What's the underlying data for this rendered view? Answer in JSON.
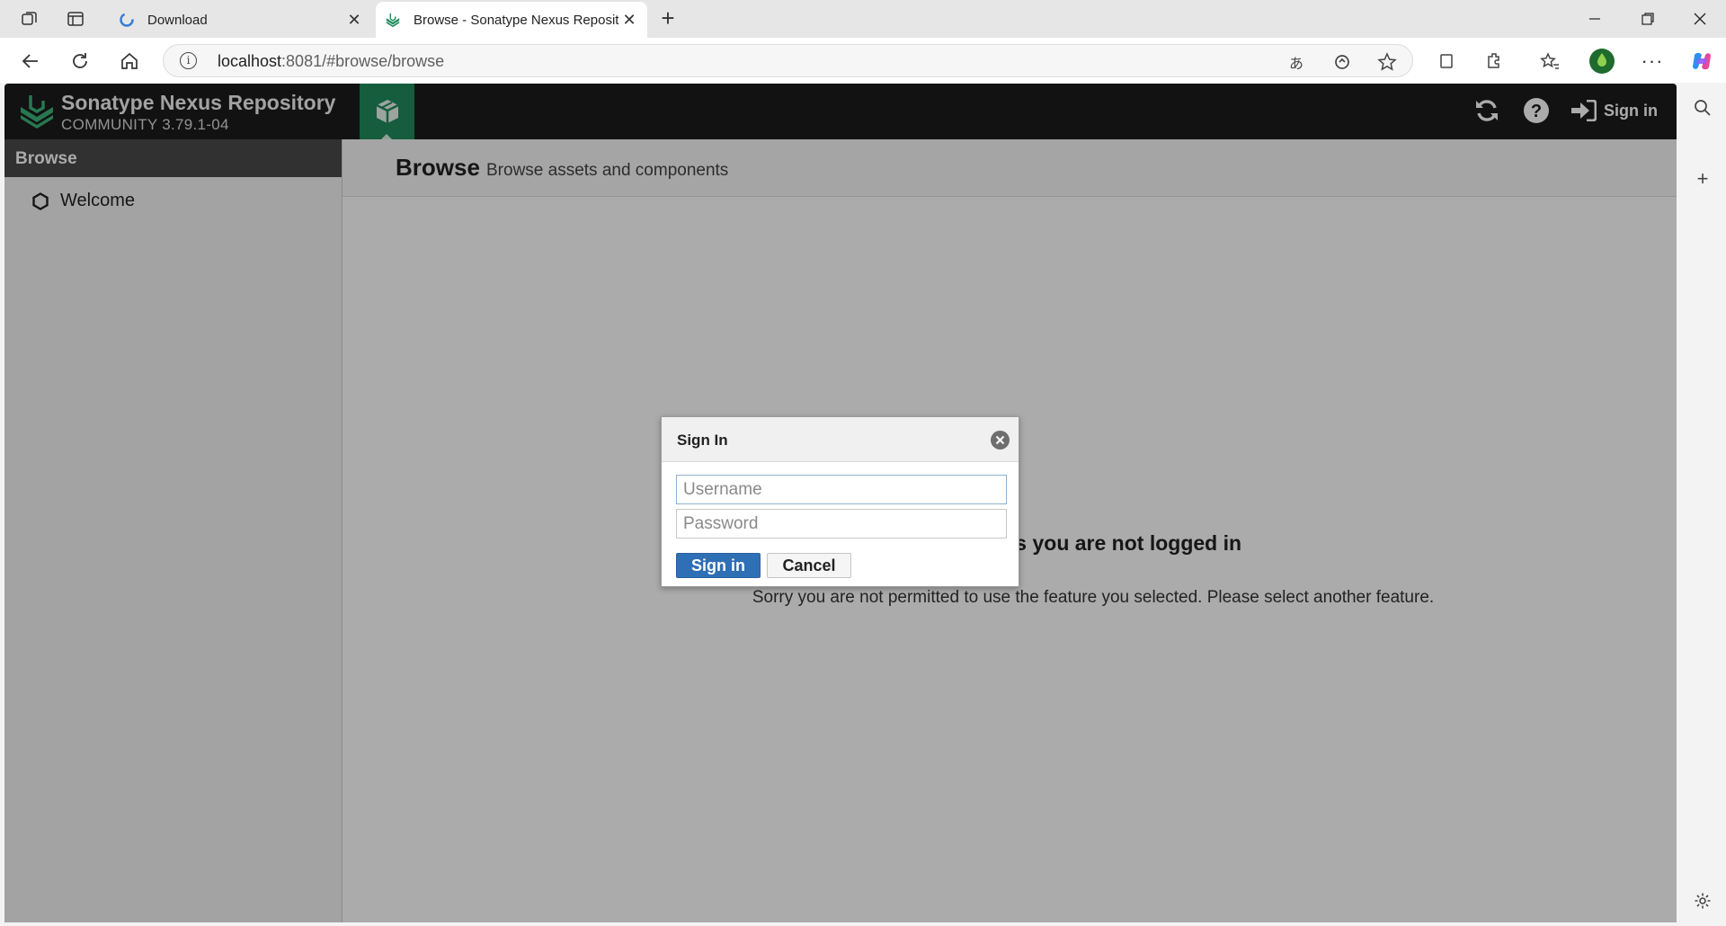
{
  "browser": {
    "tabs": [
      {
        "title": "Download",
        "favicon": "loading-ring-icon",
        "active": false
      },
      {
        "title": "Browse - Sonatype Nexus Reposit",
        "favicon": "nexus-logo-icon",
        "active": true
      }
    ],
    "address": {
      "host": "localhost",
      "path": ":8081/#browse/browse"
    }
  },
  "app": {
    "product_name": "Sonatype Nexus Repository",
    "edition": "COMMUNITY 3.79.1-04",
    "header": {
      "signin_label": "Sign in"
    },
    "sidebar": {
      "title": "Browse",
      "items": [
        {
          "label": "Welcome",
          "icon": "hexagon-icon"
        }
      ]
    },
    "content": {
      "title": "Browse",
      "subtitle": "Browse assets and components",
      "message_title": "le as you are not logged in",
      "message_text": "Sorry you are not permitted to use the feature you selected. Please select another feature."
    }
  },
  "dialog": {
    "title": "Sign In",
    "username_placeholder": "Username",
    "password_placeholder": "Password",
    "signin_label": "Sign in",
    "cancel_label": "Cancel"
  },
  "colors": {
    "header_bg": "#1c1c1c",
    "accent_green": "#208b5b",
    "primary_button": "#2f6fb5"
  }
}
